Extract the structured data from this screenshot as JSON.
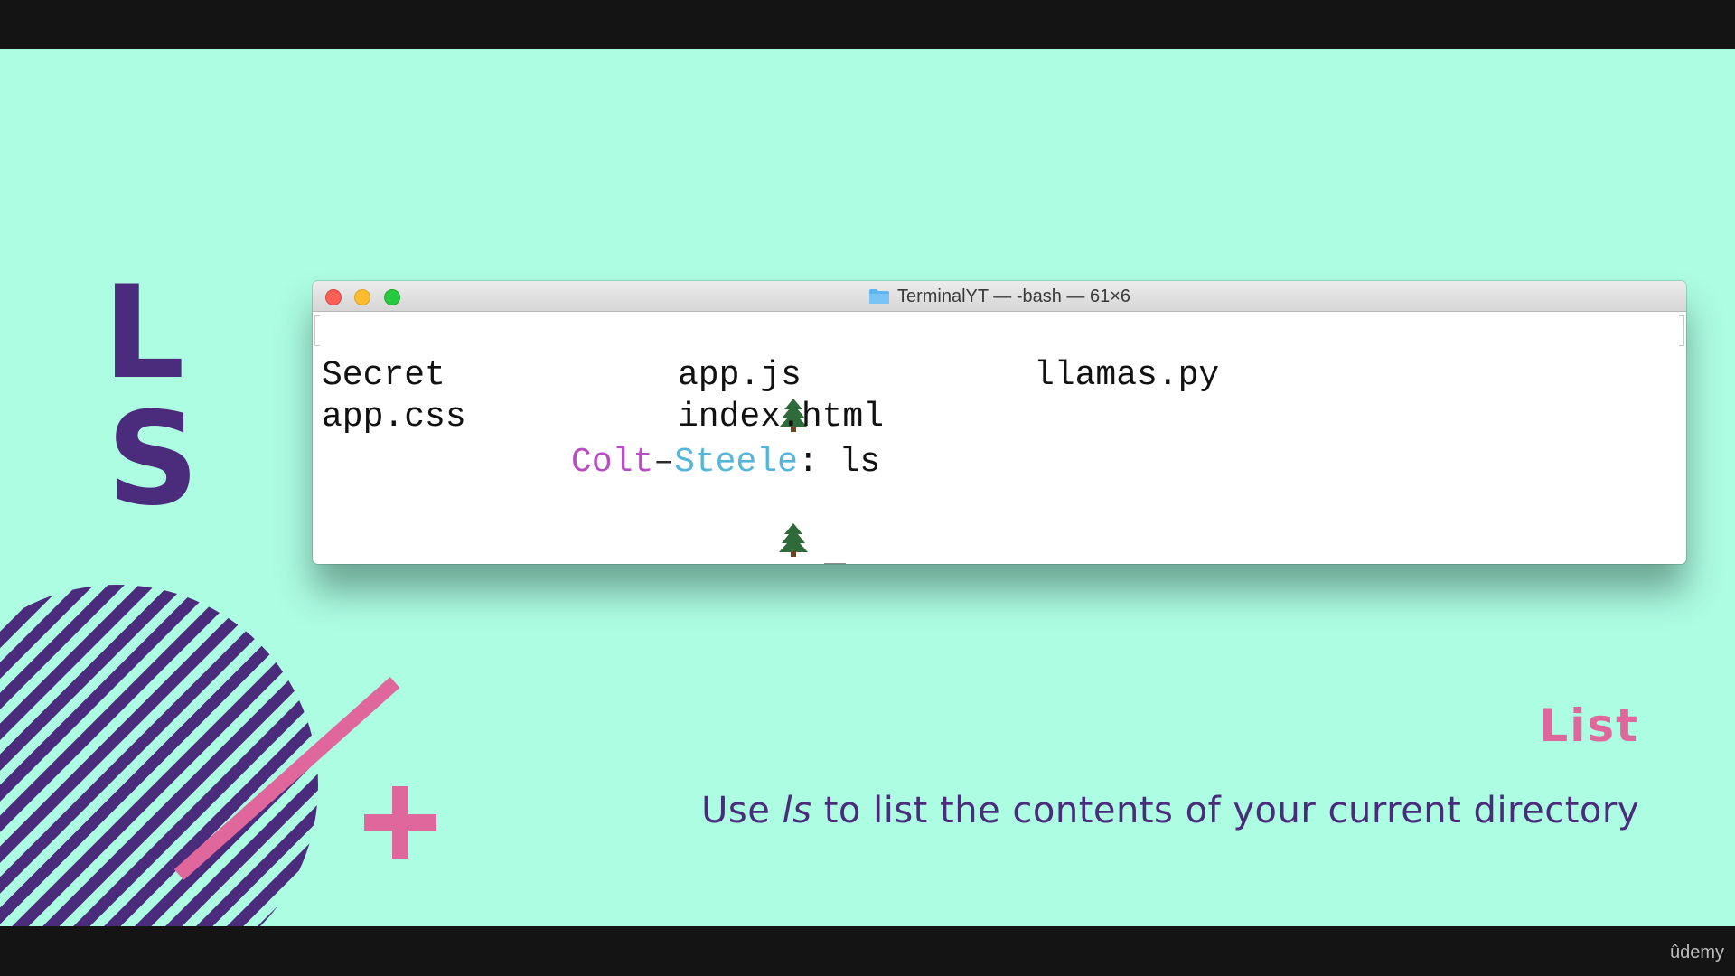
{
  "slide": {
    "big_letters": [
      "L",
      "S"
    ],
    "heading": "List",
    "caption_prefix": "Use ",
    "caption_command": "ls",
    "caption_suffix": " to list the contents of your current directory",
    "colors": {
      "background": "#adfde3",
      "purple": "#4b2b7c",
      "pink": "#e0679c"
    }
  },
  "terminal": {
    "title": "TerminalYT — -bash — 61×6",
    "title_icon": "folder-icon",
    "prompt_icon": "tree-icon",
    "prompt_user_first": "Colt",
    "prompt_dash": "–",
    "prompt_user_last": "Steele",
    "prompt_colon": ":",
    "command": "ls",
    "listing_rows": [
      [
        "Secret",
        "app.js",
        "llamas.py"
      ],
      [
        "app.css",
        "index.html",
        ""
      ]
    ]
  },
  "watermark": "ûdemy"
}
